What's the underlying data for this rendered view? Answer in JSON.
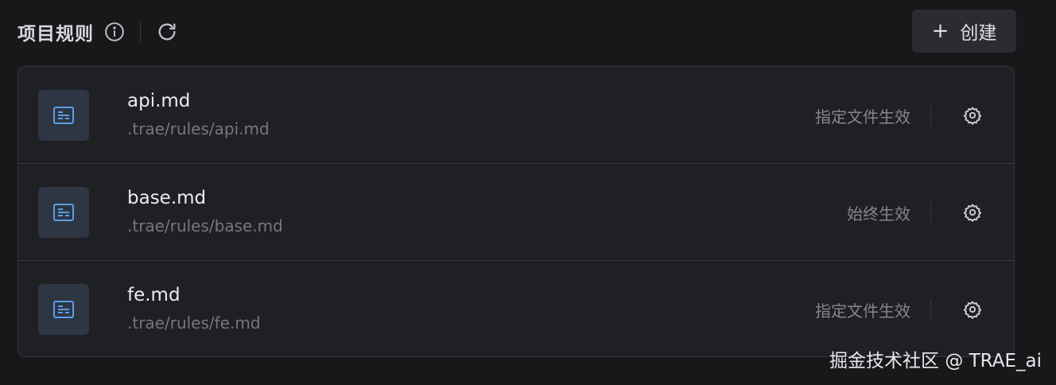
{
  "header": {
    "title": "项目规则",
    "create_label": "创建"
  },
  "rules": [
    {
      "name": "api.md",
      "path": ".trae/rules/api.md",
      "mode": "指定文件生效"
    },
    {
      "name": "base.md",
      "path": ".trae/rules/base.md",
      "mode": "始终生效"
    },
    {
      "name": "fe.md",
      "path": ".trae/rules/fe.md",
      "mode": "指定文件生效"
    }
  ],
  "watermark": "掘金技术社区 @ TRAE_ai",
  "icons": {
    "info": "info-icon",
    "refresh": "refresh-icon",
    "plus": "plus-icon",
    "file": "rule-file-icon",
    "gear": "gear-icon"
  },
  "colors": {
    "background": "#18181b",
    "panel": "#1f2024",
    "icon_tile": "#2e3644",
    "icon_accent": "#5b9ee6"
  }
}
